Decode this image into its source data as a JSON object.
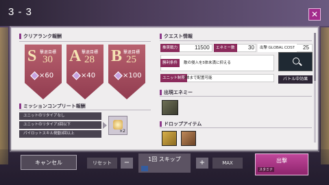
{
  "header": {
    "title": "3 - 3",
    "close_icon": "close-icon"
  },
  "left": {
    "clear_rank_title": "クリアランク報酬",
    "ranks": [
      {
        "letter": "S",
        "goal_label": "撃退目標",
        "goal": "30",
        "reward": "×60"
      },
      {
        "letter": "A",
        "goal_label": "撃退目標",
        "goal": "28",
        "reward": "×40"
      },
      {
        "letter": "B",
        "goal_label": "撃退目標",
        "goal": "25",
        "reward": "×100"
      }
    ],
    "mission_title": "ミッションコンプリート報酬",
    "missions": [
      "ユニットのリタイアなし",
      "ユニットのリタイア3回以下",
      "パイロットスキル発動3回以上"
    ],
    "mission_reward_count": "×2"
  },
  "right": {
    "quest_info_title": "クエスト情報",
    "recommended_power_label": "推奨戦力",
    "recommended_power": "11500",
    "enemy_count_label": "エネミー数",
    "enemy_count": "30",
    "global_cost_label": "出撃 GLOBAL COST",
    "global_cost": "25",
    "victory_condition_label": "勝利条件",
    "victory_condition": "敵の侵入を5体未満に抑える",
    "unit_limit_label": "ユニット制限",
    "unit_limit": "9体まで配置可能",
    "battle_effect": "バトル中効果",
    "enemy_title": "出現エネミー",
    "drop_title": "ドロップアイテム"
  },
  "footer": {
    "cancel": "キャンセル",
    "reset": "リセット",
    "minus": "−",
    "skip": "1回 スキップ",
    "plus": "+",
    "max": "MAX",
    "sortie": "出撃",
    "stamina": "スタミナ"
  },
  "colors": {
    "accent": "#a32b8c",
    "rank_red": "#913c50",
    "label_magenta": "#8b2b5c"
  }
}
